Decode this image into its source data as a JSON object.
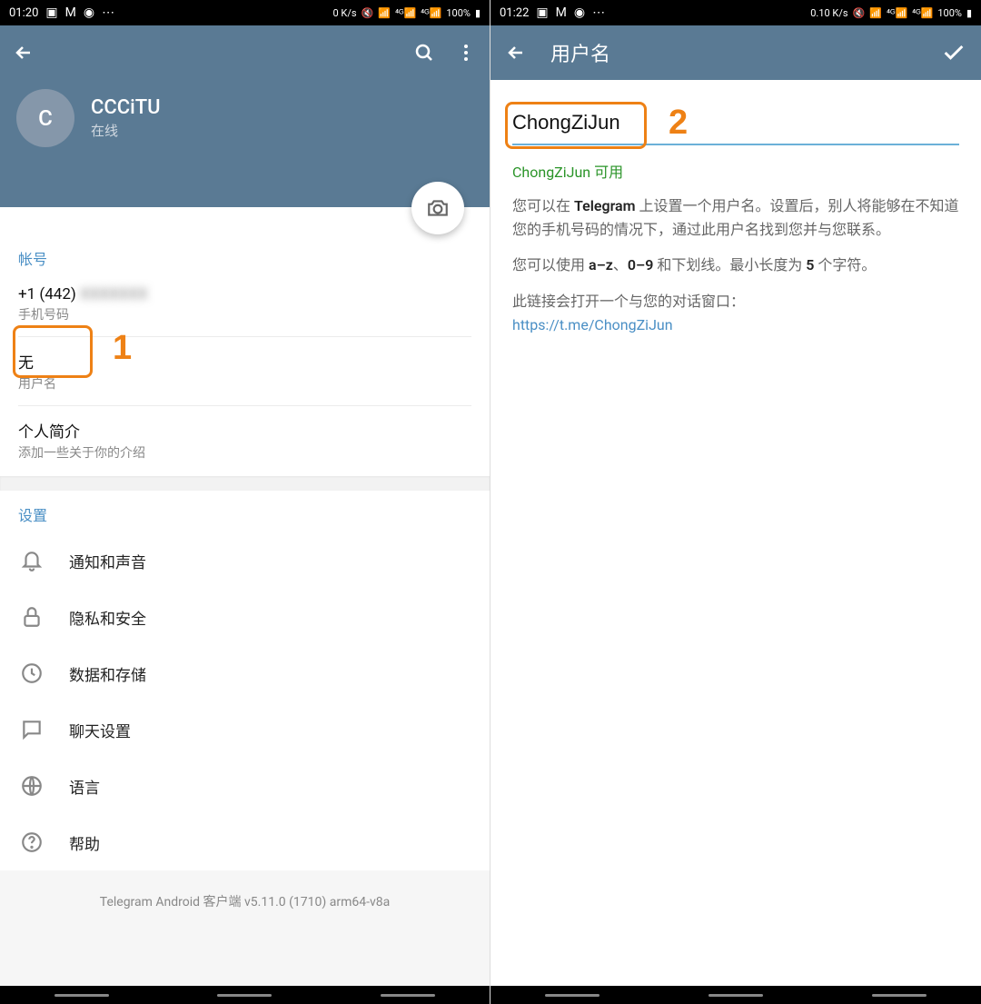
{
  "left": {
    "status": {
      "time": "01:20",
      "speed": "0 K/s",
      "battery": "100%"
    },
    "profile": {
      "avatar_letter": "C",
      "name": "CCCiTU",
      "status": "在线"
    },
    "account": {
      "section_title": "帐号",
      "phone_prefix": "+1 (442)",
      "phone_rest_masked": "XXXXXXX",
      "phone_label": "手机号码",
      "username_value": "无",
      "username_label": "用户名",
      "bio_value": "个人简介",
      "bio_label": "添加一些关于你的介绍"
    },
    "settings": {
      "section_title": "设置",
      "items": [
        {
          "label": "通知和声音",
          "icon": "bell-icon"
        },
        {
          "label": "隐私和安全",
          "icon": "lock-icon"
        },
        {
          "label": "数据和存储",
          "icon": "clock-icon"
        },
        {
          "label": "聊天设置",
          "icon": "chat-icon"
        },
        {
          "label": "语言",
          "icon": "globe-icon"
        },
        {
          "label": "帮助",
          "icon": "help-icon"
        }
      ]
    },
    "footer": "Telegram Android 客户端 v5.11.0 (1710) arm64-v8a",
    "annotation": "1"
  },
  "right": {
    "status": {
      "time": "01:22",
      "speed": "0.10 K/s",
      "battery": "100%"
    },
    "toolbar_title": "用户名",
    "input_value": "ChongZiJun",
    "availability": "ChongZiJun 可用",
    "desc1_pre": "您可以在 ",
    "desc1_bold": "Telegram",
    "desc1_post": " 上设置一个用户名。设置后，别人将能够在不知道您的手机号码的情况下，通过此用户名找到您并与您联系。",
    "desc2_pre": "您可以使用 ",
    "desc2_b1": "a–z",
    "desc2_mid1": "、",
    "desc2_b2": "0–9",
    "desc2_mid2": " 和下划线。最小长度为 ",
    "desc2_b3": "5",
    "desc2_post": " 个字符。",
    "desc3": "此链接会打开一个与您的对话窗口：",
    "link": "https://t.me/ChongZiJun",
    "annotation": "2"
  }
}
